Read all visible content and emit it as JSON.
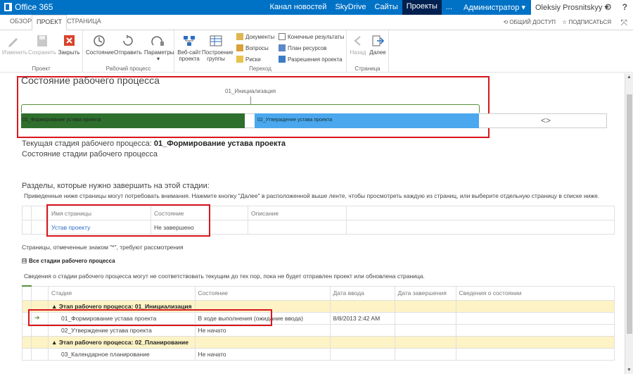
{
  "suite_bar": {
    "brand": "Office 365",
    "links": [
      "Канал новостей",
      "SkyDrive",
      "Сайты",
      "Проекты"
    ],
    "more": "...",
    "admin": "Администратор ▾",
    "user": "Oleksiy Prosnitskyy ▾",
    "help": "?"
  },
  "tabs": {
    "items": [
      "ОБЗОР",
      "ПРОЕКТ",
      "СТРАНИЦА"
    ],
    "selected": "ПРОЕКТ",
    "share": "ОБЩИЙ ДОСТУП",
    "follow": "ПОДПИСАТЬСЯ"
  },
  "ribbon": {
    "project_group": {
      "name": "Проект",
      "edit": "Изменить",
      "save": "Сохранить",
      "close": "Закрыть"
    },
    "workflow_group": {
      "name": "Рабочий процесс",
      "status": "Состояние",
      "send": "Отправить",
      "params": "Параметры"
    },
    "nav_group": {
      "name": "Переход",
      "website": "Веб-сайт проекта",
      "build_team": "Построение группы",
      "documents": "Документы",
      "issues": "Вопросы",
      "risks": "Риски",
      "deliverables": "Конечные результаты",
      "resource_plan": "План ресурсов",
      "permissions": "Разрешения проекта"
    },
    "page_group": {
      "name": "Страница",
      "back": "Назад",
      "next": "Далее"
    }
  },
  "workflow": {
    "title": "Состояние рабочего процесса",
    "phase_label": "01_Инициализация",
    "stage1": "01_Формирование устава проекта",
    "stage2": "02_Утверждение устава проекта",
    "more_icon": "<>"
  },
  "current_stage": {
    "prefix": "Текущая стадия рабочего процесса: ",
    "name": "01_Формирование устава проекта",
    "status_label": "Состояние стадии рабочего процесса"
  },
  "required_pages": {
    "title": "Разделы, которые нужно завершить на этой стадии:",
    "description": "Приведенные ниже страницы могут потребовать внимания. Нажмите кнопку \"Далее\" в расположенной выше ленте, чтобы просмотреть каждую из страниц, или выберите отдельную страницу в списке ниже.",
    "columns": [
      "Имя страницы",
      "Состояние",
      "Описание"
    ],
    "rows": [
      {
        "name": "Устав проекту",
        "status": "Не завершено",
        "desc": ""
      }
    ],
    "note": "Страницы, отмеченные знаком \"*\", требуют рассмотрения"
  },
  "all_stages": {
    "toggle": "⊟",
    "title": "Все стадии рабочего процесса",
    "info": "Сведения о стадии рабочего процесса могут не соответствовать текущим до тех пор, пока не будет отправлен проект или обновлена страница.",
    "columns": [
      "Стадия",
      "Состояние",
      "Дата ввода",
      "Дата завершения",
      "Сведения о состоянии"
    ],
    "rows": [
      {
        "type": "group",
        "stage": "▲ Этап рабочего процесса: 01_Инициализация",
        "status": "",
        "entered": "",
        "completed": "",
        "info": ""
      },
      {
        "type": "stage",
        "current": true,
        "stage": "01_Формирование устава проекта",
        "status": "В ходе выполнения (ожидание ввода)",
        "entered": "8/8/2013 2:42 AM",
        "completed": "",
        "info": ""
      },
      {
        "type": "stage",
        "current": false,
        "stage": "02_Утверждение устава проекта",
        "status": "Не начато",
        "entered": "",
        "completed": "",
        "info": ""
      },
      {
        "type": "group",
        "stage": "▲ Этап рабочего процесса: 02_Планирование",
        "status": "",
        "entered": "",
        "completed": "",
        "info": ""
      },
      {
        "type": "stage",
        "current": false,
        "stage": "03_Календарное планирование",
        "status": "Не начато",
        "entered": "",
        "completed": "",
        "info": ""
      }
    ]
  }
}
